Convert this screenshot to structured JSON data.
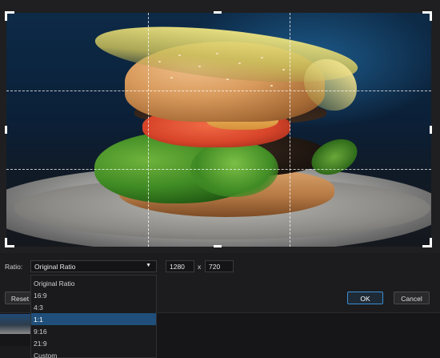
{
  "dialog": {
    "ratio_label": "Ratio:",
    "ratio_selected": "Original Ratio",
    "width_value": "1280",
    "height_value": "720",
    "separator": "x",
    "reset_label": "Reset",
    "ok_label": "OK",
    "cancel_label": "Cancel"
  },
  "ratio_options": [
    "Original Ratio",
    "16:9",
    "4:3",
    "1:1",
    "9:16",
    "21:9",
    "Custom"
  ],
  "highlighted_option": "1:1",
  "icons": {
    "dropdown_arrow": "▼"
  },
  "colors": {
    "accent": "#3a8fd4",
    "highlight": "#1f4f7a"
  }
}
